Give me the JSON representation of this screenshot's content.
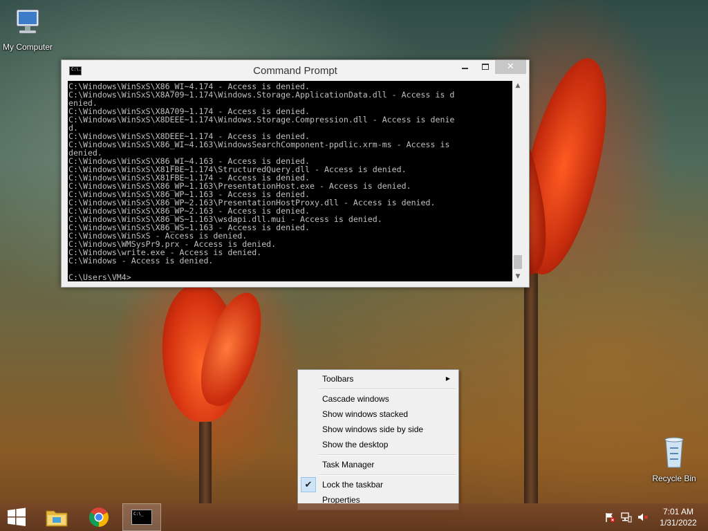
{
  "desktop": {
    "icons": [
      {
        "label": "My Computer"
      },
      {
        "label": "Recycle Bin"
      }
    ]
  },
  "cmd_window": {
    "title": "Command Prompt",
    "icon_text": "C:\\.",
    "close_glyph": "✕",
    "lines": [
      "C:\\Windows\\WinSxS\\X86_WI~4.174 - Access is denied.",
      "C:\\Windows\\WinSxS\\X8A709~1.174\\Windows.Storage.ApplicationData.dll - Access is d",
      "enied.",
      "C:\\Windows\\WinSxS\\X8A709~1.174 - Access is denied.",
      "C:\\Windows\\WinSxS\\X8DEEE~1.174\\Windows.Storage.Compression.dll - Access is denie",
      "d.",
      "C:\\Windows\\WinSxS\\X8DEEE~1.174 - Access is denied.",
      "C:\\Windows\\WinSxS\\X86_WI~4.163\\WindowsSearchComponent-ppdlic.xrm-ms - Access is",
      "denied.",
      "C:\\Windows\\WinSxS\\X86_WI~4.163 - Access is denied.",
      "C:\\Windows\\WinSxS\\X81FBE~1.174\\StructuredQuery.dll - Access is denied.",
      "C:\\Windows\\WinSxS\\X81FBE~1.174 - Access is denied.",
      "C:\\Windows\\WinSxS\\X86_WP~1.163\\PresentationHost.exe - Access is denied.",
      "C:\\Windows\\WinSxS\\X86_WP~1.163 - Access is denied.",
      "C:\\Windows\\WinSxS\\X86_WP~2.163\\PresentationHostProxy.dll - Access is denied.",
      "C:\\Windows\\WinSxS\\X86_WP~2.163 - Access is denied.",
      "C:\\Windows\\WinSxS\\X86_WS~1.163\\wsdapi.dll.mui - Access is denied.",
      "C:\\Windows\\WinSxS\\X86_WS~1.163 - Access is denied.",
      "C:\\Windows\\WinSxS - Access is denied.",
      "C:\\Windows\\WMSysPr9.prx - Access is denied.",
      "C:\\Windows\\write.exe - Access is denied.",
      "C:\\Windows - Access is denied.",
      "",
      "C:\\Users\\VM4>"
    ]
  },
  "context_menu": {
    "toolbars": "Toolbars",
    "cascade": "Cascade windows",
    "stacked": "Show windows stacked",
    "side_by_side": "Show windows side by side",
    "show_desktop": "Show the desktop",
    "task_manager": "Task Manager",
    "lock_taskbar": "Lock the taskbar",
    "lock_taskbar_checked": true,
    "properties": "Properties"
  },
  "taskbar": {
    "pinned": [
      {
        "icon": "windows-start-icon"
      },
      {
        "icon": "file-explorer-icon"
      },
      {
        "icon": "chrome-icon"
      },
      {
        "icon": "command-prompt-icon",
        "active": true
      }
    ],
    "tray": [
      "action-center-flag-icon",
      "network-icon",
      "volume-muted-icon"
    ],
    "clock": {
      "time": "7:01 AM",
      "date": "1/31/2022"
    }
  }
}
